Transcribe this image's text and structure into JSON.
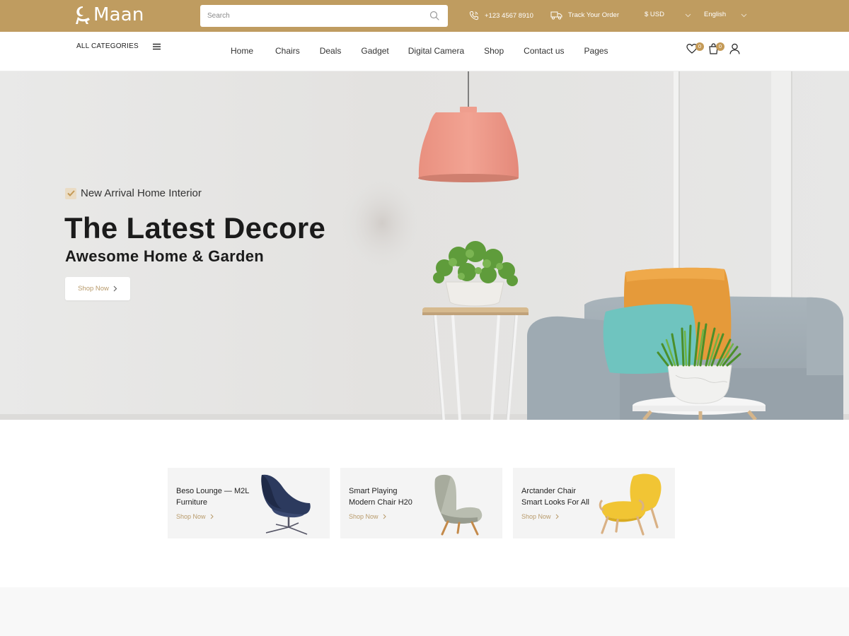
{
  "brand": {
    "name": "Maan"
  },
  "topbar": {
    "search_placeholder": "Search",
    "phone": "+123 4567 8910",
    "track_order": "Track Your Order",
    "currency": "$ USD",
    "language": "English"
  },
  "nav": {
    "all_categories": "ALL CATEGORIES",
    "menu": [
      "Home",
      "Chairs",
      "Deals",
      "Gadget",
      "Digital Camera",
      "Shop",
      "Contact us",
      "Pages"
    ],
    "wishlist_count": "0",
    "cart_count": "0"
  },
  "hero": {
    "tagline": "New Arrival Home Interior",
    "title": "The Latest Decore",
    "subtitle": "Awesome Home & Garden",
    "button": "Shop Now"
  },
  "cards": [
    {
      "line1": "Beso Lounge — M2L",
      "line2": "Furniture",
      "link": "Shop Now"
    },
    {
      "line1": "Smart Playing",
      "line2": "Modern Chair H20",
      "link": "Shop Now"
    },
    {
      "line1": "Arctander Chair",
      "line2": "Smart Looks For All",
      "link": "Shop Now"
    }
  ],
  "colors": {
    "topbar": "#bf9c60",
    "accent": "#c49a57",
    "link": "#b89a6a",
    "hero_bg": "#e6e5e3",
    "card_bg": "#f4f4f4"
  },
  "icons": [
    "maan-logo-icon",
    "search-icon",
    "phone-icon",
    "truck-icon",
    "chevron-down-icon",
    "menu-icon",
    "heart-icon",
    "cart-icon",
    "user-icon",
    "check-icon",
    "chevron-right-icon"
  ]
}
